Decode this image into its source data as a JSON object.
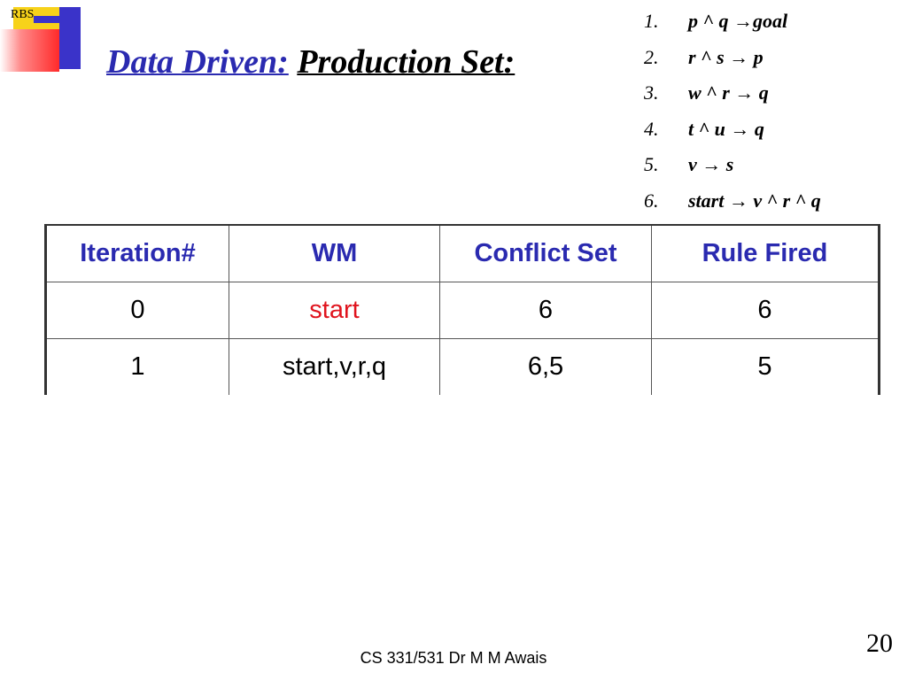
{
  "logo": {
    "text": "RBS"
  },
  "title": {
    "part1": "Data Driven:",
    "part2": "Production Set:"
  },
  "rules": [
    {
      "num": "1.",
      "text": "p ^ q →goal"
    },
    {
      "num": "2.",
      "text": "r ^ s → p"
    },
    {
      "num": "3.",
      "text": "w ^ r → q"
    },
    {
      "num": "4.",
      "text": "t ^ u → q"
    },
    {
      "num": "5.",
      "text": "v → s"
    },
    {
      "num": "6.",
      "text": "start → v ^ r ^ q"
    }
  ],
  "table": {
    "headers": [
      "Iteration#",
      "WM",
      "Conflict Set",
      "Rule Fired"
    ],
    "rows": [
      [
        "0",
        "start",
        "6",
        "6"
      ],
      [
        "1",
        "start,v,r,q",
        "6,5",
        "5"
      ]
    ],
    "highlight_color": "#e0141e",
    "header_color": "#2a2ab0"
  },
  "footer": "CS 331/531 Dr M M Awais",
  "page_number": "20"
}
